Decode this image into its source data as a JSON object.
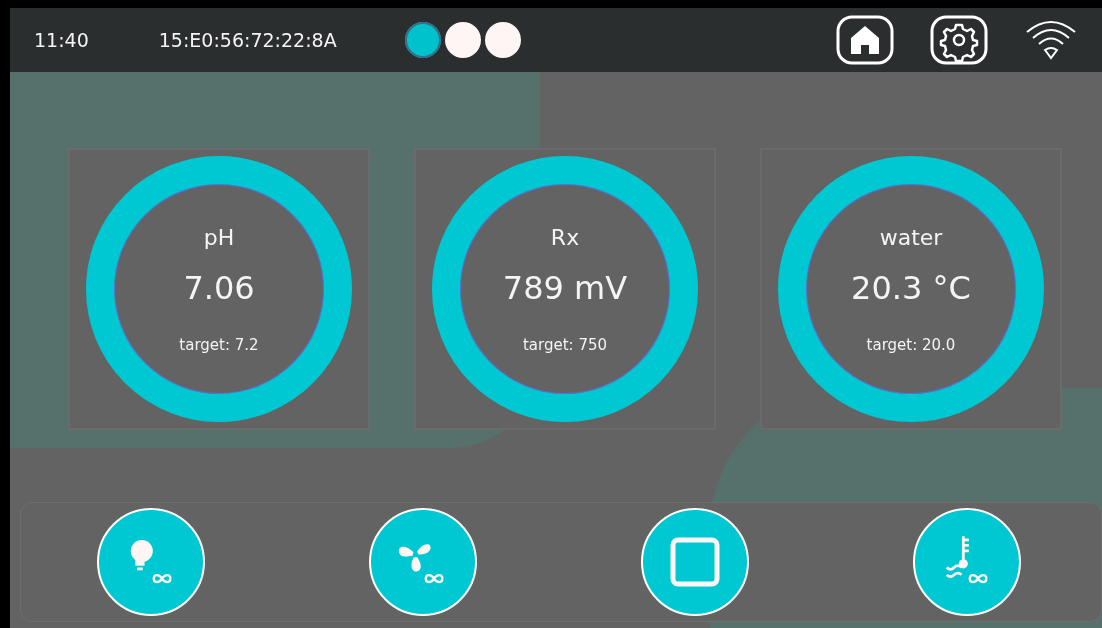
{
  "status_bar": {
    "time": "11:40",
    "device_address": "15:E0:56:72:22:8A",
    "pages": [
      {
        "selected": true
      },
      {
        "selected": false
      },
      {
        "selected": false
      }
    ]
  },
  "gauges": [
    {
      "label": "pH",
      "value": "7.06",
      "target": "target: 7.2"
    },
    {
      "label": "Rx",
      "value": "789 mV",
      "target": "target: 750"
    },
    {
      "label": "water",
      "value": "20.3 °C",
      "target": "target: 20.0"
    }
  ],
  "actions": [
    {
      "kind": "light"
    },
    {
      "kind": "fan"
    },
    {
      "kind": "stop"
    },
    {
      "kind": "heater"
    }
  ]
}
